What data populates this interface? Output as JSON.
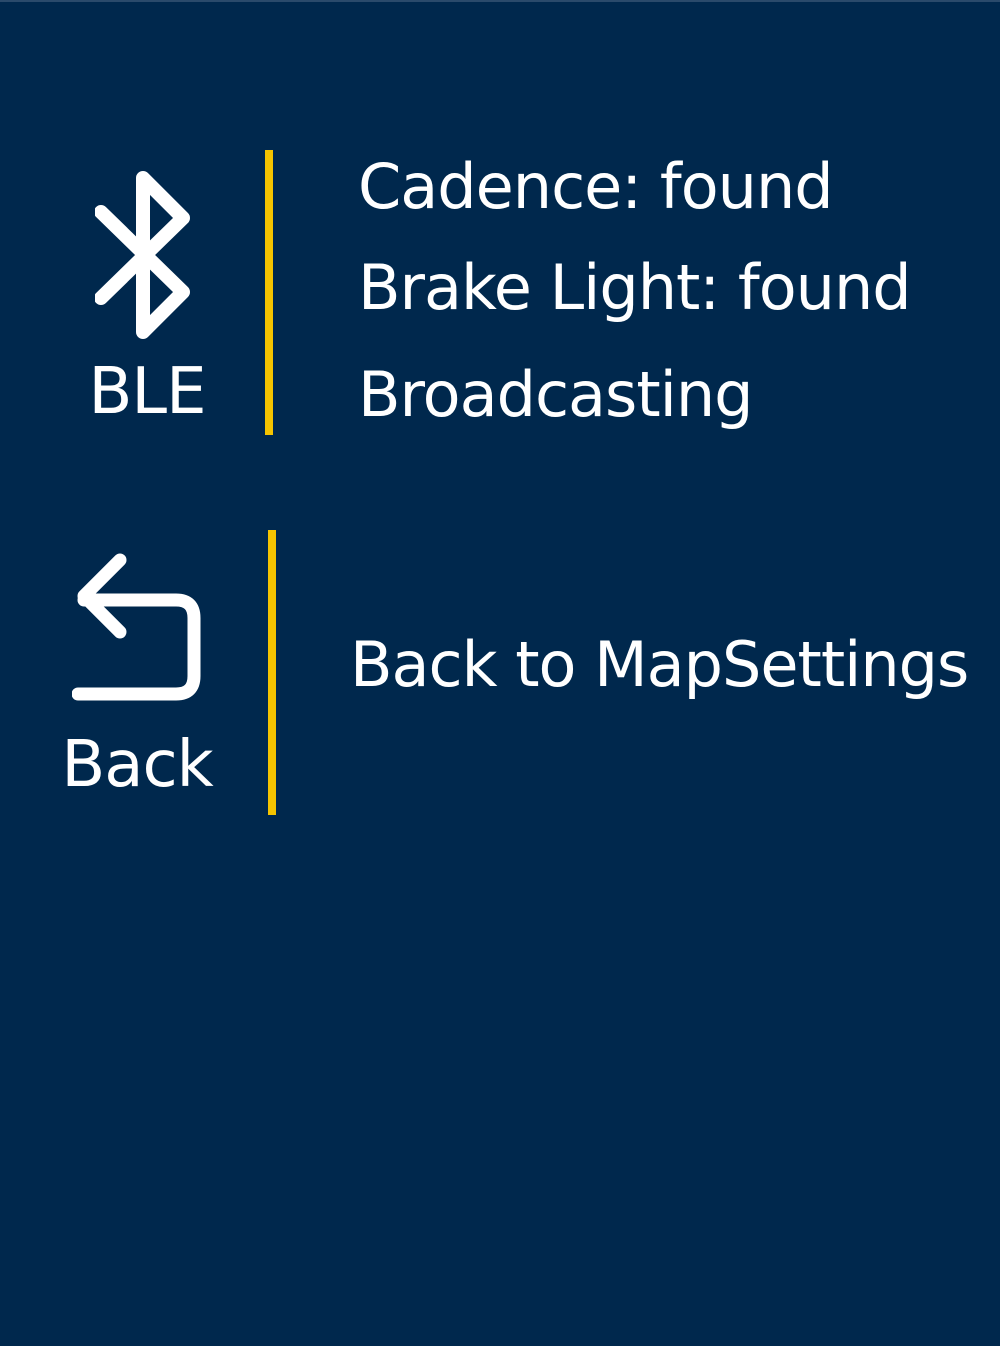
{
  "colors": {
    "background": "#00284d",
    "accent": "#f5c400",
    "text": "#ffffff"
  },
  "ble": {
    "icon": "bluetooth-icon",
    "label": "BLE",
    "status_lines": [
      "Cadence: found",
      "Brake Light: found",
      "Broadcasting"
    ]
  },
  "back": {
    "icon": "back-arrow-icon",
    "label": "Back",
    "action_text": "Back to MapSettings"
  }
}
